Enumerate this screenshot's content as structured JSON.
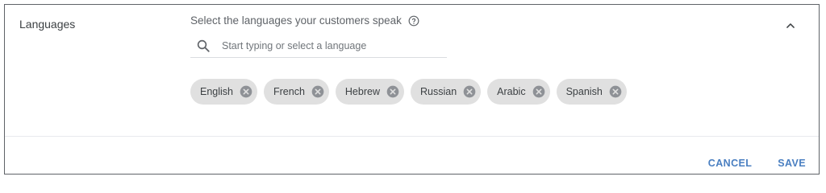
{
  "section": {
    "label": "Languages"
  },
  "helper": {
    "text": "Select the languages your customers speak",
    "icon": "help-circle-icon"
  },
  "search": {
    "placeholder": "Start typing or select a language",
    "value": "",
    "icon": "search-icon"
  },
  "chips": [
    {
      "label": "English"
    },
    {
      "label": "French"
    },
    {
      "label": "Hebrew"
    },
    {
      "label": "Russian"
    },
    {
      "label": "Arabic"
    },
    {
      "label": "Spanish"
    }
  ],
  "actions": {
    "cancel_label": "CANCEL",
    "save_label": "SAVE"
  },
  "colors": {
    "accent": "#4a7fc1",
    "chip_background": "#e0e0e0",
    "chip_remove": "#8e9196",
    "text": "#3c4043",
    "muted_text": "#5f6368"
  }
}
